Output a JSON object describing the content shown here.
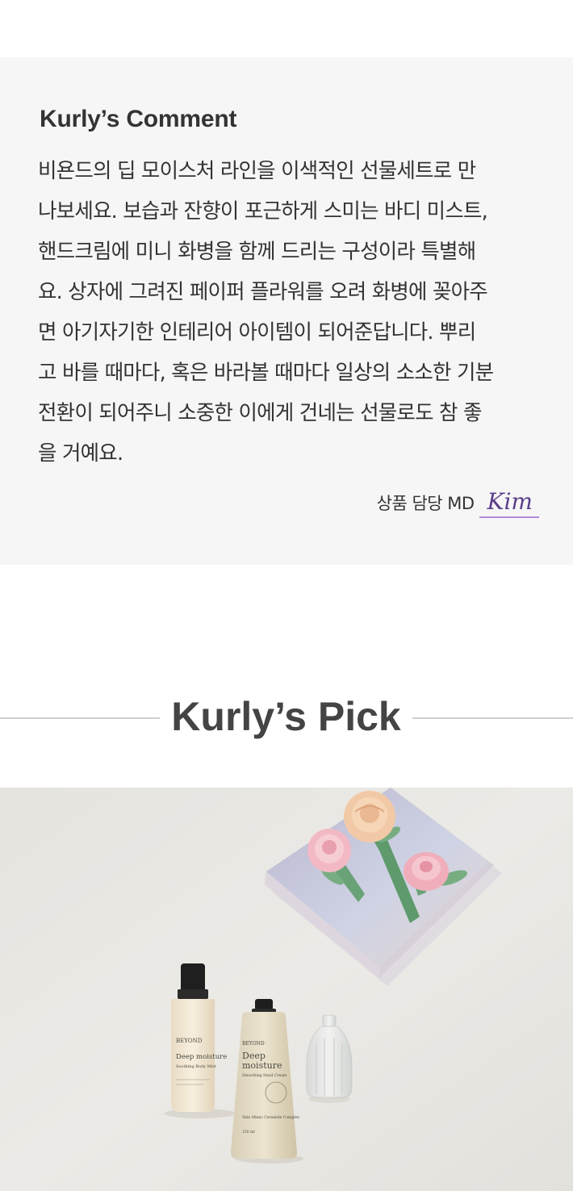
{
  "comment": {
    "title": "Kurly’s Comment",
    "lines": [
      "비욘드의 딥 모이스처 라인을 이색적인 선물세트로 만",
      "나보세요. 보습과 잔향이 포근하게 스미는 바디 미스트,",
      "핸드크림에 미니 화병을 함께 드리는 구성이라 특별해",
      "요. 상자에 그려진 페이퍼 플라워를 오려 화병에 꽂아주",
      "면 아기자기한 인테리어 아이템이 되어준답니다. 뿌리",
      "고 바를 때마다, 혹은 바라볼 때마다 일상의 소소한 기분",
      "전환이 되어주니 소중한 이에게 건네는 선물로도 참 좋",
      "을 거예요."
    ],
    "signature_label": "상품 담당 MD",
    "signature_name": "Kim"
  },
  "pick": {
    "title": "Kurly’s Pick"
  },
  "product_photo": {
    "mist_brand": "BEYOND",
    "mist_name": "Deep moisture",
    "mist_sub": "Soothing Body Mist",
    "cream_brand": "BEYOND",
    "cream_name_1": "Deep",
    "cream_name_2": "moisture",
    "cream_sub": "Smoothing Hand Cream",
    "cream_complex": "Skin Mimic Ceramide Complex",
    "cream_volume": "150 ml"
  },
  "colors": {
    "comment_bg": "#f6f6f6",
    "signature_underline": "#b48ad6",
    "divider": "#cfcfcf"
  }
}
